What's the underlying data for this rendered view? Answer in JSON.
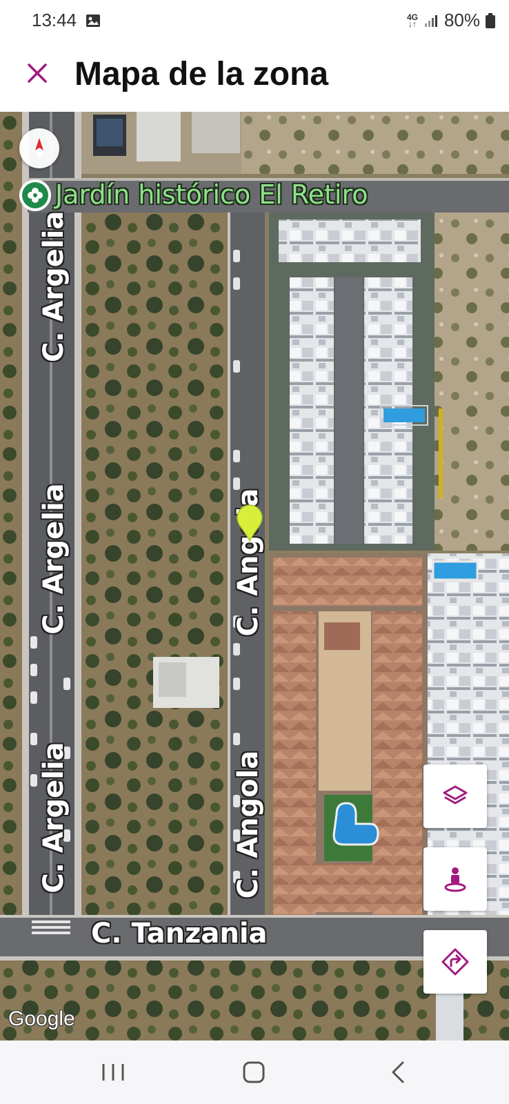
{
  "status_bar": {
    "time": "13:44",
    "network": "4G",
    "battery": "80%",
    "icons": [
      "image-icon",
      "signal-icon",
      "battery-icon"
    ]
  },
  "header": {
    "title": "Mapa de la zona",
    "close_icon": "close-icon",
    "accent_color": "#a21a7d"
  },
  "map": {
    "poi": {
      "name": "Jardín histórico El Retiro",
      "icon": "garden-icon",
      "color": "#8fe08a"
    },
    "streets": [
      {
        "id": "argelia-1",
        "name": "C. Argelia"
      },
      {
        "id": "argelia-2",
        "name": "C. Argelia"
      },
      {
        "id": "argelia-3",
        "name": "C. Argelia"
      },
      {
        "id": "angola-1",
        "name": "C. Angola"
      },
      {
        "id": "angola-2",
        "name": "C. Angola"
      },
      {
        "id": "tanzania",
        "name": "C. Tanzania"
      }
    ],
    "attribution": "Google",
    "marker_color": "#d7ef3b",
    "controls": [
      "layers-icon",
      "street-view-icon",
      "directions-icon"
    ],
    "compass_icon": "compass-icon"
  },
  "nav_bar": {
    "buttons": [
      "recent-apps-icon",
      "home-icon",
      "back-icon"
    ]
  }
}
